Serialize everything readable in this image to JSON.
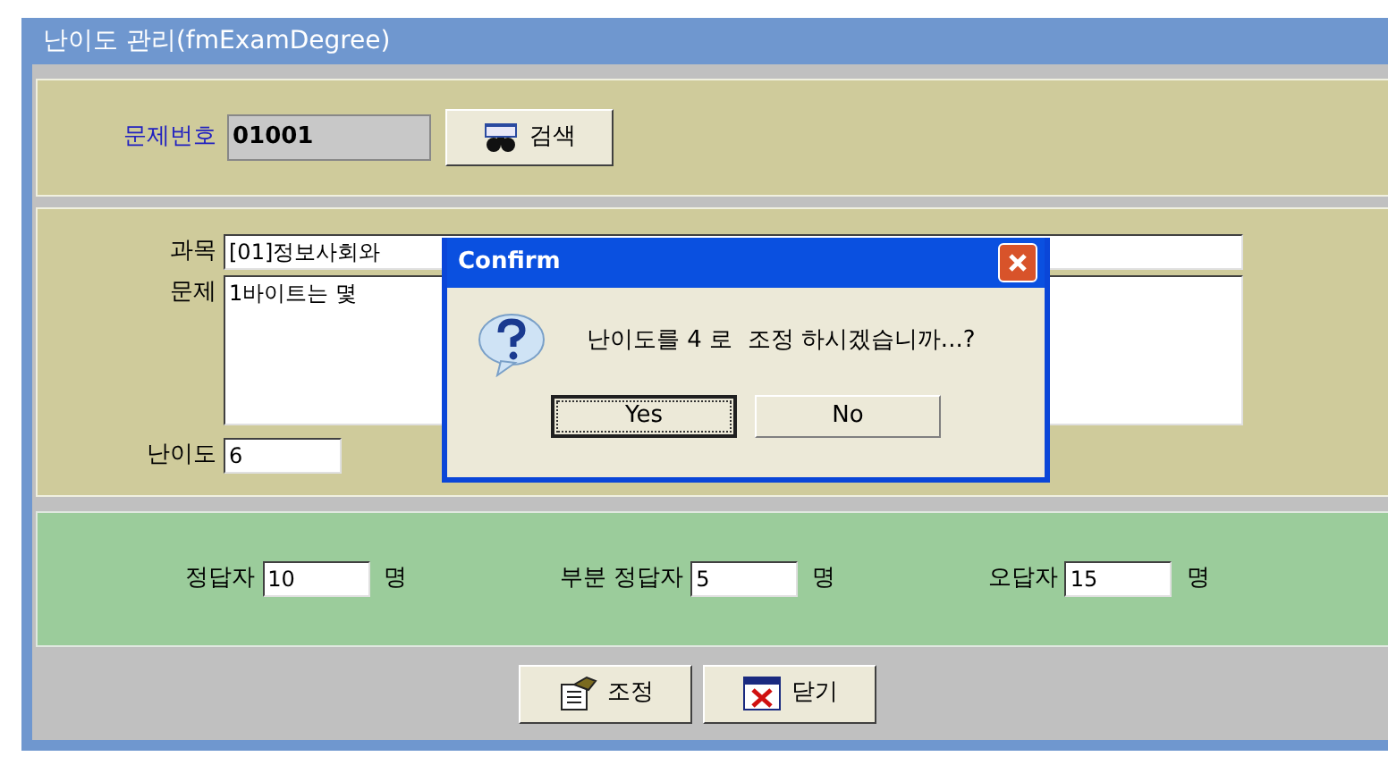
{
  "window": {
    "title": "난이도 관리(fmExamDegree)"
  },
  "search": {
    "label": "문제번호",
    "value": "01001",
    "button": "검색"
  },
  "question": {
    "subject_label": "과목",
    "subject_value": "[01]정보사회와",
    "question_label": "문제",
    "question_value": "1바이트는 몇",
    "degree_label": "난이도",
    "degree_value": "6"
  },
  "stats": [
    {
      "label": "정답자",
      "value": "10",
      "unit": "명"
    },
    {
      "label": "부분 정답자",
      "value": "5",
      "unit": "명"
    },
    {
      "label": "오답자",
      "value": "15",
      "unit": "명"
    }
  ],
  "buttons": [
    {
      "kind": "adjust",
      "label": "조정"
    },
    {
      "kind": "close",
      "label": "닫기"
    }
  ],
  "dialog": {
    "title": "Confirm",
    "message": "난이도를 4 로  조정 하시겠습니까...?",
    "buttons": [
      {
        "label": "Yes",
        "focused": true
      },
      {
        "label": "No",
        "focused": false
      }
    ]
  }
}
